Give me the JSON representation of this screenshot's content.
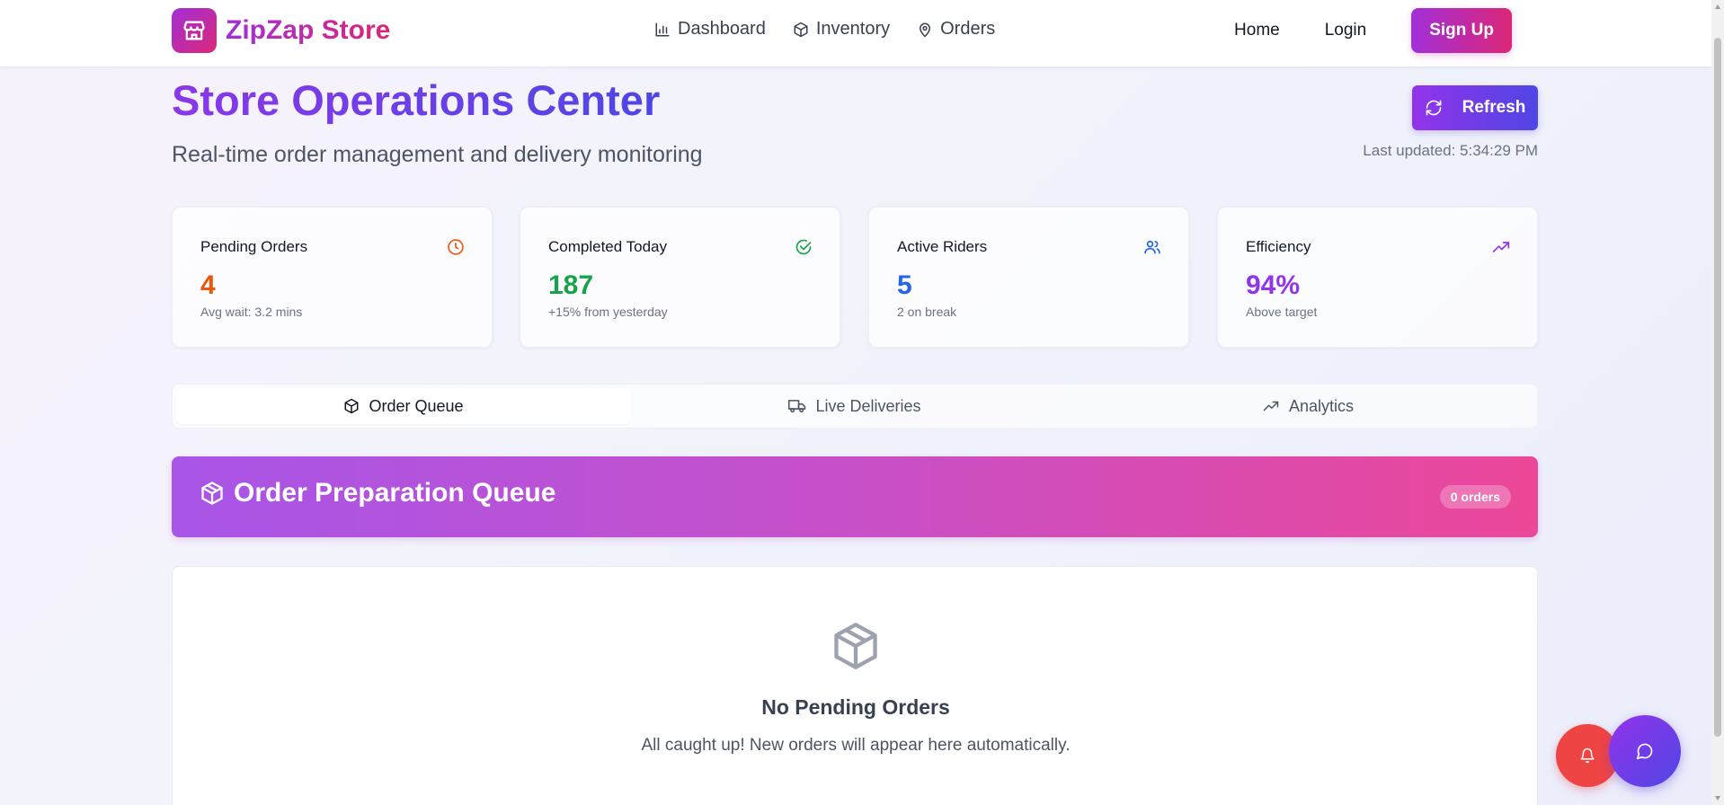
{
  "header": {
    "brand": "ZipZap Store",
    "nav": [
      {
        "label": "Dashboard",
        "icon": "bar-chart-icon"
      },
      {
        "label": "Inventory",
        "icon": "package-icon"
      },
      {
        "label": "Orders",
        "icon": "map-pin-icon"
      }
    ],
    "home_label": "Home",
    "login_label": "Login",
    "signup_label": "Sign Up"
  },
  "page": {
    "title": "Store Operations Center",
    "subtitle": "Real-time order management and delivery monitoring",
    "refresh_label": "Refresh",
    "last_updated": "Last updated: 5:34:29 PM"
  },
  "stats": [
    {
      "label": "Pending Orders",
      "value": "4",
      "note": "Avg wait: 3.2 mins",
      "icon": "clock-icon",
      "color": "#ea580c"
    },
    {
      "label": "Completed Today",
      "value": "187",
      "note": "+15% from yesterday",
      "icon": "check-circle-icon",
      "color": "#16a34a"
    },
    {
      "label": "Active Riders",
      "value": "5",
      "note": "2 on break",
      "icon": "users-icon",
      "color": "#2563eb"
    },
    {
      "label": "Efficiency",
      "value": "94%",
      "note": "Above target",
      "icon": "trending-up-icon",
      "color": "#9333ea"
    }
  ],
  "tabs": [
    {
      "label": "Order Queue",
      "icon": "package-icon",
      "active": true
    },
    {
      "label": "Live Deliveries",
      "icon": "truck-icon",
      "active": false
    },
    {
      "label": "Analytics",
      "icon": "trending-up-icon",
      "active": false
    }
  ],
  "queue": {
    "title": "Order Preparation Queue",
    "badge": "0 orders",
    "empty_title": "No Pending Orders",
    "empty_text": "All caught up! New orders will appear here automatically."
  },
  "colors": {
    "brand_start": "#a22fd8",
    "brand_end": "#db2777",
    "accent_indigo": "#4f46e5",
    "notify_red": "#ef4444"
  }
}
